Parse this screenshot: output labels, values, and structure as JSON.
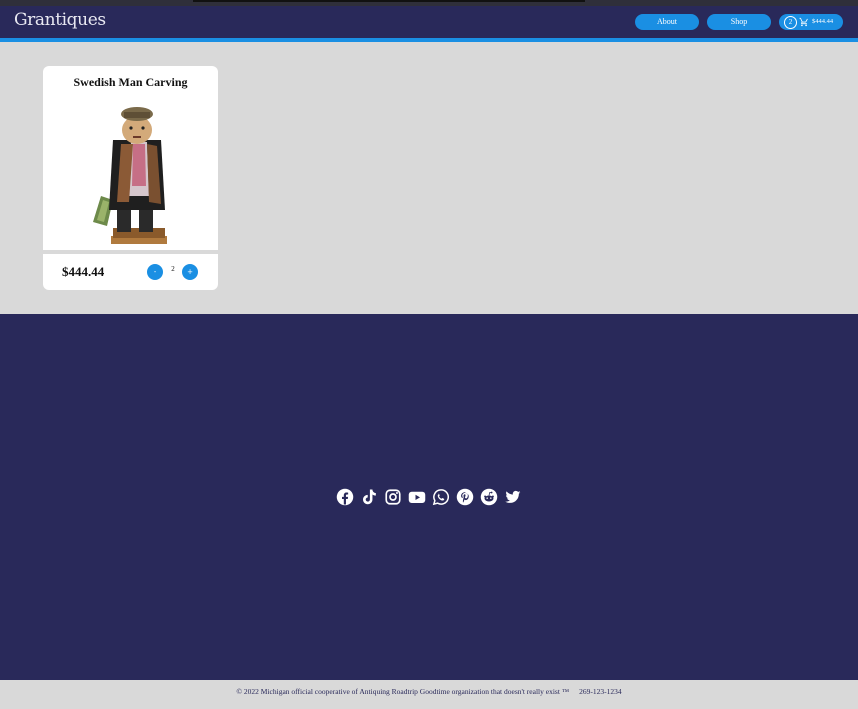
{
  "header": {
    "brand": "Grantiques",
    "nav": {
      "about": "About",
      "shop": "Shop"
    },
    "cart": {
      "count": "2",
      "total": "$444.44",
      "icon": "shopping-cart-icon"
    }
  },
  "products": [
    {
      "title": "Swedish Man Carving",
      "price": "$444.44",
      "quantity": "2",
      "decrement_label": "-",
      "increment_label": "+"
    }
  ],
  "footer": {
    "socials": [
      "facebook-icon",
      "tiktok-icon",
      "instagram-icon",
      "youtube-icon",
      "whatsapp-icon",
      "pinterest-icon",
      "reddit-icon",
      "twitter-icon"
    ],
    "copyright": "© 2022 Michigan official cooperative of Antiquing Roadtrip Goodtime organization that doesn't really exist ™",
    "phone": "269-123-1234"
  },
  "colors": {
    "navy": "#29295a",
    "accent": "#1a8fe3",
    "background": "#d9d9d9"
  }
}
